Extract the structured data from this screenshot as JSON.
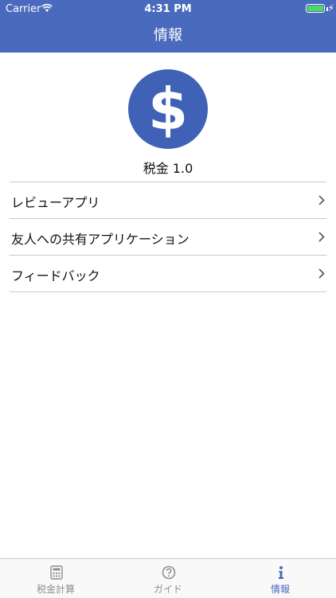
{
  "status_bar": {
    "carrier": "Carrier",
    "time": "4:31 PM"
  },
  "nav": {
    "title": "情報"
  },
  "app": {
    "icon_symbol": "$",
    "version_text": "税金 1.0",
    "accent": "#4062b6"
  },
  "menu": {
    "items": [
      {
        "label": "レビューアプリ"
      },
      {
        "label": "友人への共有アプリケーション"
      },
      {
        "label": "フィードバック"
      }
    ]
  },
  "tabbar": {
    "items": [
      {
        "label": "税金計算",
        "icon": "calculator-icon",
        "active": false
      },
      {
        "label": "ガイド",
        "icon": "help-icon",
        "active": false
      },
      {
        "label": "情報",
        "icon": "info-icon",
        "active": true
      }
    ]
  },
  "colors": {
    "nav": "#4a6bbd",
    "active_tab": "#4a6bbd",
    "battery": "#4cd964"
  }
}
